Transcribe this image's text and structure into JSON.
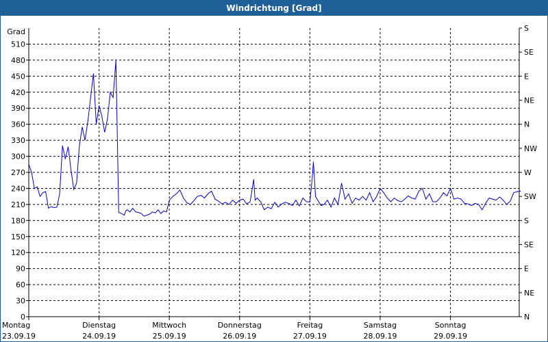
{
  "window": {
    "title": "Windrichtung [Grad]"
  },
  "chart_data": {
    "type": "line",
    "title": "Windrichtung [Grad]",
    "ylabel": "Grad",
    "ylim": [
      0,
      540
    ],
    "y_ticks": [
      0,
      30,
      60,
      90,
      120,
      150,
      180,
      210,
      240,
      270,
      300,
      330,
      360,
      390,
      420,
      450,
      480,
      510
    ],
    "y2_labels": [
      "N",
      "NE",
      "E",
      "SE",
      "S",
      "SW",
      "W",
      "NW",
      "N",
      "NE",
      "E",
      "SE",
      "S"
    ],
    "x_days": [
      {
        "day": "Montag",
        "date": "23.09.19"
      },
      {
        "day": "Dienstag",
        "date": "24.09.19"
      },
      {
        "day": "Mittwoch",
        "date": "25.09.19"
      },
      {
        "day": "Donnerstag",
        "date": "26.09.19"
      },
      {
        "day": "Freitag",
        "date": "27.09.19"
      },
      {
        "day": "Samstag",
        "date": "28.09.19"
      },
      {
        "day": "Sonntag",
        "date": "29.09.19"
      }
    ],
    "grid": true,
    "series": [
      {
        "color": "#0000c8",
        "x": [
          0.0,
          0.04,
          0.08,
          0.12,
          0.16,
          0.2,
          0.24,
          0.28,
          0.32,
          0.36,
          0.4,
          0.44,
          0.48,
          0.52,
          0.56,
          0.6,
          0.64,
          0.68,
          0.72,
          0.76,
          0.8,
          0.84,
          0.88,
          0.92,
          0.96,
          1.0,
          1.04,
          1.08,
          1.12,
          1.16,
          1.2,
          1.24,
          1.28,
          1.32,
          1.36,
          1.38,
          1.4,
          1.44,
          1.48,
          1.52,
          1.56,
          1.6,
          1.64,
          1.68,
          1.72,
          1.76,
          1.8,
          1.84,
          1.88,
          1.92,
          1.96,
          2.0,
          2.05,
          2.1,
          2.15,
          2.2,
          2.25,
          2.3,
          2.35,
          2.4,
          2.45,
          2.5,
          2.55,
          2.6,
          2.65,
          2.7,
          2.75,
          2.8,
          2.85,
          2.9,
          2.95,
          3.0,
          3.05,
          3.1,
          3.15,
          3.2,
          3.22,
          3.25,
          3.3,
          3.35,
          3.4,
          3.45,
          3.5,
          3.55,
          3.6,
          3.65,
          3.7,
          3.75,
          3.8,
          3.85,
          3.9,
          3.95,
          4.0,
          4.03,
          4.05,
          4.08,
          4.12,
          4.16,
          4.2,
          4.25,
          4.3,
          4.35,
          4.4,
          4.45,
          4.5,
          4.55,
          4.6,
          4.65,
          4.7,
          4.75,
          4.8,
          4.85,
          4.9,
          4.95,
          5.0,
          5.05,
          5.1,
          5.15,
          5.2,
          5.25,
          5.3,
          5.35,
          5.4,
          5.45,
          5.5,
          5.55,
          5.6,
          5.65,
          5.7,
          5.75,
          5.8,
          5.85,
          5.9,
          5.95,
          6.0,
          6.05,
          6.1,
          6.15,
          6.2,
          6.25,
          6.3,
          6.35,
          6.4,
          6.45,
          6.5,
          6.55,
          6.6,
          6.65,
          6.7,
          6.75,
          6.8,
          6.85,
          6.9,
          6.95,
          7.0
        ],
        "y": [
          285,
          270,
          240,
          243,
          225,
          232,
          234,
          203,
          206,
          204,
          205,
          230,
          320,
          295,
          318,
          275,
          238,
          250,
          320,
          355,
          330,
          365,
          410,
          455,
          360,
          395,
          375,
          345,
          370,
          420,
          410,
          480,
          195,
          193,
          190,
          198,
          200,
          196,
          203,
          196,
          195,
          193,
          188,
          190,
          192,
          196,
          194,
          200,
          193,
          198,
          196,
          218,
          225,
          230,
          237,
          222,
          213,
          210,
          217,
          225,
          227,
          222,
          230,
          235,
          220,
          216,
          211,
          214,
          210,
          218,
          212,
          218,
          220,
          211,
          215,
          257,
          218,
          222,
          215,
          200,
          205,
          202,
          214,
          205,
          211,
          214,
          212,
          208,
          218,
          207,
          222,
          215,
          215,
          255,
          290,
          225,
          216,
          208,
          210,
          218,
          205,
          222,
          210,
          250,
          220,
          230,
          212,
          222,
          218,
          225,
          218,
          232,
          215,
          225,
          240,
          232,
          222,
          215,
          222,
          217,
          215,
          220,
          226,
          222,
          220,
          235,
          240,
          220,
          230,
          215,
          215,
          222,
          232,
          226,
          240,
          220,
          222,
          220,
          212,
          211,
          208,
          212,
          210,
          200,
          212,
          222,
          220,
          218,
          224,
          218,
          210,
          216,
          232,
          234,
          235
        ]
      }
    ]
  }
}
